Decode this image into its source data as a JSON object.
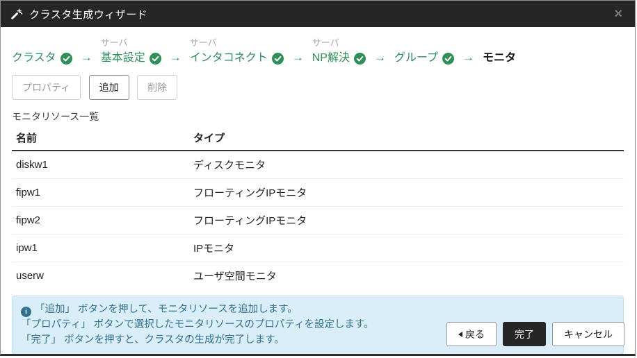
{
  "window": {
    "title": "クラスタ生成ウィザード"
  },
  "steps": {
    "server_sublabel": "サーバ",
    "arrow_glyph": "→",
    "items": [
      {
        "label": "クラスタ",
        "sublabel": "",
        "checked": true,
        "current": false
      },
      {
        "label": "基本設定",
        "sublabel": "サーバ",
        "checked": true,
        "current": false
      },
      {
        "label": "インタコネクト",
        "sublabel": "サーバ",
        "checked": true,
        "current": false
      },
      {
        "label": "NP解決",
        "sublabel": "サーバ",
        "checked": true,
        "current": false
      },
      {
        "label": "グループ",
        "sublabel": "",
        "checked": true,
        "current": false
      },
      {
        "label": "モニタ",
        "sublabel": "",
        "checked": false,
        "current": true
      }
    ]
  },
  "toolbar": {
    "properties_label": "プロパティ",
    "add_label": "追加",
    "remove_label": "削除"
  },
  "list": {
    "caption": "モニタリソース一覧",
    "columns": [
      "名前",
      "タイプ"
    ],
    "rows": [
      [
        "diskw1",
        "ディスクモニタ"
      ],
      [
        "fipw1",
        "フローティングIPモニタ"
      ],
      [
        "fipw2",
        "フローティングIPモニタ"
      ],
      [
        "ipw1",
        "IPモニタ"
      ],
      [
        "userw",
        "ユーザ空間モニタ"
      ]
    ]
  },
  "info": {
    "lines": [
      "「追加」 ボタンを押して、モニタリソースを追加します。",
      "「プロパティ」 ボタンで選択したモニタリソースのプロパティを設定します。",
      "「完了」 ボタンを押すと、クラスタの生成が完了します。"
    ]
  },
  "footer": {
    "back_label": "戻る",
    "finish_label": "完了",
    "cancel_label": "キャンセル"
  },
  "icons": {
    "title": "magic-wand-icon",
    "close": "close-icon",
    "step_done": "check-circle-icon",
    "info": "info-circle-icon",
    "back": "left-triangle-icon"
  },
  "colors": {
    "title_bar": "#262626",
    "accent_green": "#2e8f58",
    "info_bg": "#d9eef8",
    "info_border": "#bfe2f0",
    "info_text": "#31708f"
  }
}
